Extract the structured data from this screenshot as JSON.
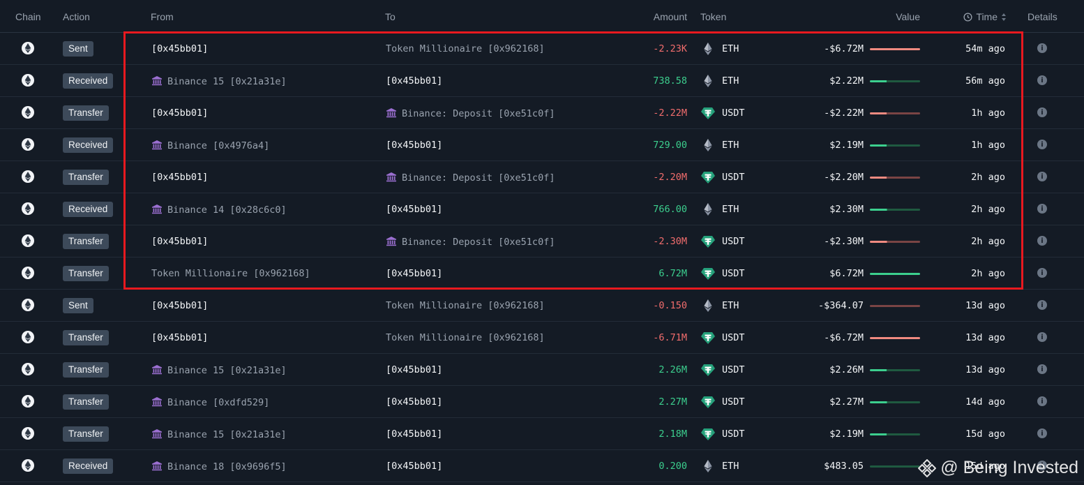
{
  "headers": {
    "chain": "Chain",
    "action": "Action",
    "from": "From",
    "to": "To",
    "amount": "Amount",
    "token": "Token",
    "value": "Value",
    "time": "Time",
    "details": "Details"
  },
  "rows": [
    {
      "action": "Sent",
      "from": "[0x45bb01]",
      "from_style": "white",
      "from_bank": false,
      "to": "Token Millionaire [0x962168]",
      "to_style": "gray",
      "to_bank": false,
      "amount": "-2.23K",
      "amount_sign": "neg",
      "token": "ETH",
      "token_icon": "eth-icon",
      "value": "-$6.72M",
      "bar_fill": 1.0,
      "bar_sign": "neg",
      "time": "54m ago"
    },
    {
      "action": "Received",
      "from": "Binance 15 [0x21a31e]",
      "from_style": "gray",
      "from_bank": true,
      "to": "[0x45bb01]",
      "to_style": "white",
      "to_bank": false,
      "amount": "738.58",
      "amount_sign": "pos",
      "token": "ETH",
      "token_icon": "eth-icon",
      "value": "$2.22M",
      "bar_fill": 0.33,
      "bar_sign": "pos",
      "time": "56m ago"
    },
    {
      "action": "Transfer",
      "from": "[0x45bb01]",
      "from_style": "white",
      "from_bank": false,
      "to": "Binance: Deposit [0xe51c0f]",
      "to_style": "gray",
      "to_bank": true,
      "amount": "-2.22M",
      "amount_sign": "neg",
      "token": "USDT",
      "token_icon": "usdt-icon",
      "value": "-$2.22M",
      "bar_fill": 0.33,
      "bar_sign": "neg",
      "time": "1h ago"
    },
    {
      "action": "Received",
      "from": "Binance [0x4976a4]",
      "from_style": "gray",
      "from_bank": true,
      "to": "[0x45bb01]",
      "to_style": "white",
      "to_bank": false,
      "amount": "729.00",
      "amount_sign": "pos",
      "token": "ETH",
      "token_icon": "eth-icon",
      "value": "$2.19M",
      "bar_fill": 0.33,
      "bar_sign": "pos",
      "time": "1h ago"
    },
    {
      "action": "Transfer",
      "from": "[0x45bb01]",
      "from_style": "white",
      "from_bank": false,
      "to": "Binance: Deposit [0xe51c0f]",
      "to_style": "gray",
      "to_bank": true,
      "amount": "-2.20M",
      "amount_sign": "neg",
      "token": "USDT",
      "token_icon": "usdt-icon",
      "value": "-$2.20M",
      "bar_fill": 0.33,
      "bar_sign": "neg",
      "time": "2h ago"
    },
    {
      "action": "Received",
      "from": "Binance 14 [0x28c6c0]",
      "from_style": "gray",
      "from_bank": true,
      "to": "[0x45bb01]",
      "to_style": "white",
      "to_bank": false,
      "amount": "766.00",
      "amount_sign": "pos",
      "token": "ETH",
      "token_icon": "eth-icon",
      "value": "$2.30M",
      "bar_fill": 0.34,
      "bar_sign": "pos",
      "time": "2h ago"
    },
    {
      "action": "Transfer",
      "from": "[0x45bb01]",
      "from_style": "white",
      "from_bank": false,
      "to": "Binance: Deposit [0xe51c0f]",
      "to_style": "gray",
      "to_bank": true,
      "amount": "-2.30M",
      "amount_sign": "neg",
      "token": "USDT",
      "token_icon": "usdt-icon",
      "value": "-$2.30M",
      "bar_fill": 0.34,
      "bar_sign": "neg",
      "time": "2h ago"
    },
    {
      "action": "Transfer",
      "from": "Token Millionaire [0x962168]",
      "from_style": "gray",
      "from_bank": false,
      "to": "[0x45bb01]",
      "to_style": "white",
      "to_bank": false,
      "amount": "6.72M",
      "amount_sign": "pos",
      "token": "USDT",
      "token_icon": "usdt-icon",
      "value": "$6.72M",
      "bar_fill": 1.0,
      "bar_sign": "pos",
      "time": "2h ago"
    },
    {
      "action": "Sent",
      "from": "[0x45bb01]",
      "from_style": "white",
      "from_bank": false,
      "to": "Token Millionaire [0x962168]",
      "to_style": "gray",
      "to_bank": false,
      "amount": "-0.150",
      "amount_sign": "neg",
      "token": "ETH",
      "token_icon": "eth-icon",
      "value": "-$364.07",
      "bar_fill": 0.0,
      "bar_sign": "neg",
      "time": "13d ago"
    },
    {
      "action": "Transfer",
      "from": "[0x45bb01]",
      "from_style": "white",
      "from_bank": false,
      "to": "Token Millionaire [0x962168]",
      "to_style": "gray",
      "to_bank": false,
      "amount": "-6.71M",
      "amount_sign": "neg",
      "token": "USDT",
      "token_icon": "usdt-icon",
      "value": "-$6.72M",
      "bar_fill": 1.0,
      "bar_sign": "neg",
      "time": "13d ago"
    },
    {
      "action": "Transfer",
      "from": "Binance 15 [0x21a31e]",
      "from_style": "gray",
      "from_bank": true,
      "to": "[0x45bb01]",
      "to_style": "white",
      "to_bank": false,
      "amount": "2.26M",
      "amount_sign": "pos",
      "token": "USDT",
      "token_icon": "usdt-icon",
      "value": "$2.26M",
      "bar_fill": 0.33,
      "bar_sign": "pos",
      "time": "13d ago"
    },
    {
      "action": "Transfer",
      "from": "Binance [0xdfd529]",
      "from_style": "gray",
      "from_bank": true,
      "to": "[0x45bb01]",
      "to_style": "white",
      "to_bank": false,
      "amount": "2.27M",
      "amount_sign": "pos",
      "token": "USDT",
      "token_icon": "usdt-icon",
      "value": "$2.27M",
      "bar_fill": 0.34,
      "bar_sign": "pos",
      "time": "14d ago"
    },
    {
      "action": "Transfer",
      "from": "Binance 15 [0x21a31e]",
      "from_style": "gray",
      "from_bank": true,
      "to": "[0x45bb01]",
      "to_style": "white",
      "to_bank": false,
      "amount": "2.18M",
      "amount_sign": "pos",
      "token": "USDT",
      "token_icon": "usdt-icon",
      "value": "$2.19M",
      "bar_fill": 0.33,
      "bar_sign": "pos",
      "time": "15d ago"
    },
    {
      "action": "Received",
      "from": "Binance 18 [0x9696f5]",
      "from_style": "gray",
      "from_bank": true,
      "to": "[0x45bb01]",
      "to_style": "white",
      "to_bank": false,
      "amount": "0.200",
      "amount_sign": "pos",
      "token": "ETH",
      "token_icon": "eth-icon",
      "value": "$483.05",
      "bar_fill": 0.0,
      "bar_sign": "pos",
      "time": "15d ago"
    }
  ],
  "watermark": {
    "text": "@ Being Invested",
    "icon": "binance-logo-icon"
  },
  "colors": {
    "background": "#141b25",
    "negative": "#f26d6d",
    "positive": "#3ccf8e",
    "highlight": "#e8191f",
    "bank_icon": "#9b6fd1",
    "usdt": "#26a17b"
  }
}
